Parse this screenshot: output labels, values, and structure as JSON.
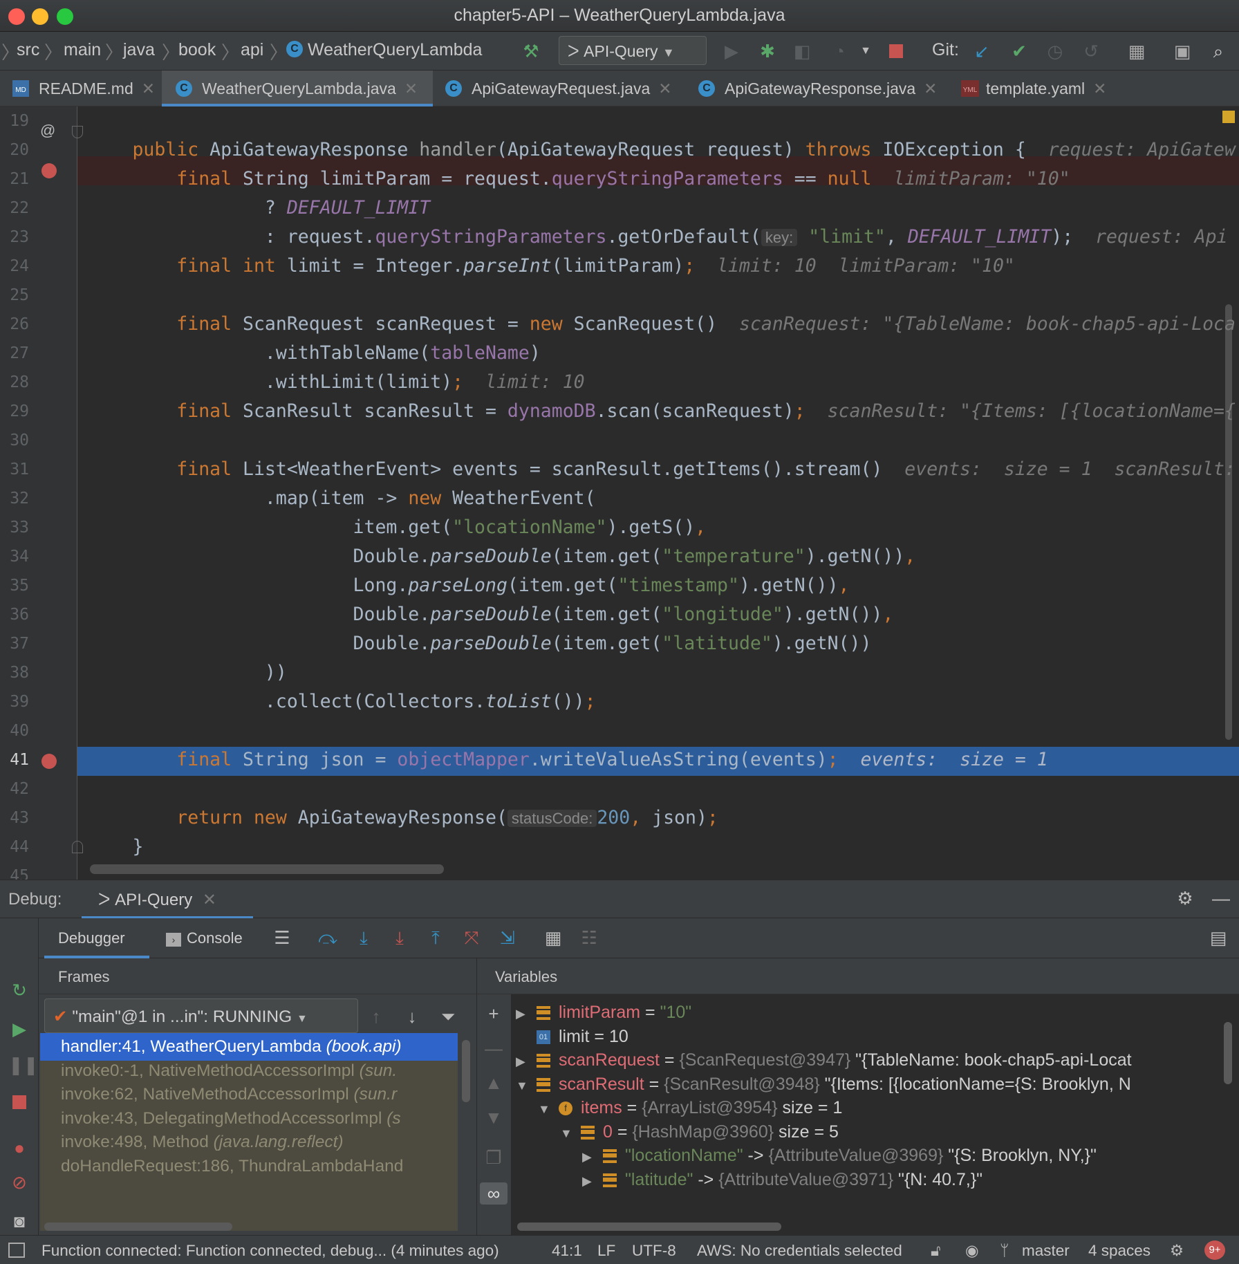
{
  "window": {
    "title": "chapter5-API – WeatherQueryLambda.java"
  },
  "breadcrumb": [
    "src",
    "main",
    "java",
    "book",
    "api",
    "WeatherQueryLambda"
  ],
  "toolbar": {
    "run_config": "API-Query",
    "git_label": "Git:"
  },
  "tabs": [
    {
      "label": "README.md",
      "icon": "markdown-icon"
    },
    {
      "label": "WeatherQueryLambda.java",
      "icon": "class-icon",
      "active": true
    },
    {
      "label": "ApiGatewayRequest.java",
      "icon": "class-icon"
    },
    {
      "label": "ApiGatewayResponse.java",
      "icon": "class-icon"
    },
    {
      "label": "template.yaml",
      "icon": "yaml-icon"
    }
  ],
  "editor": {
    "line_numbers": [
      "19",
      "20",
      "21",
      "22",
      "23",
      "24",
      "25",
      "26",
      "27",
      "28",
      "29",
      "30",
      "31",
      "32",
      "33",
      "34",
      "35",
      "36",
      "37",
      "38",
      "39",
      "40",
      "41",
      "42",
      "43",
      "44",
      "45"
    ],
    "hints": {
      "l20": "request: ApiGatew",
      "l21": "limitParam: \"10\"",
      "l23_key": "key:",
      "l23": "request: Api",
      "l24a": "limit: 10",
      "l24b": "limitParam: \"10\"",
      "l26": "scanRequest: \"{TableName: book-chap5-api-Loca",
      "l28": "limit: 10",
      "l29": "scanResult: \"{Items: [{locationName={",
      "l31a": "events:",
      "l31b": "size = 1",
      "l31c": "scanResult:",
      "l41a": "events:",
      "l41b": "size = 1",
      "l43_param": "statusCode:"
    }
  },
  "debug": {
    "title": "Debug:",
    "session_tab": "API-Query",
    "tabs": [
      "Debugger",
      "Console"
    ],
    "frames_header": "Frames",
    "variables_header": "Variables",
    "thread": "\"main\"@1 in ...in\": RUNNING",
    "frames": [
      {
        "method": "handler:41, WeatherQueryLambda",
        "pkg": "(book.api)"
      },
      {
        "method": "invoke0:-1, NativeMethodAccessorImpl",
        "pkg": "(sun."
      },
      {
        "method": "invoke:62, NativeMethodAccessorImpl",
        "pkg": "(sun.r"
      },
      {
        "method": "invoke:43, DelegatingMethodAccessorImpl",
        "pkg": "(s"
      },
      {
        "method": "invoke:498, Method",
        "pkg": "(java.lang.reflect)"
      },
      {
        "method": "doHandleRequest:186, ThundraLambdaHand",
        "pkg": ""
      }
    ],
    "variables": [
      {
        "name": "limitParam",
        "eq": " = ",
        "value": "\"10\"",
        "ref": "",
        "extra": ""
      },
      {
        "name": "limit",
        "eq": " = ",
        "value": "10",
        "ref": "",
        "extra": ""
      },
      {
        "name": "scanRequest",
        "eq": " = ",
        "value": "",
        "ref": "{ScanRequest@3947}",
        "extra": " \"{TableName: book-chap5-api-Locat"
      },
      {
        "name": "scanResult",
        "eq": " = ",
        "value": "",
        "ref": "{ScanResult@3948}",
        "extra": " \"{Items: [{locationName={S: Brooklyn, N"
      },
      {
        "name": "items",
        "eq": " = ",
        "value": "",
        "ref": "{ArrayList@3954}",
        "extra": "  size = 1"
      },
      {
        "name": "0",
        "eq": " = ",
        "value": "",
        "ref": "{HashMap@3960}",
        "extra": "  size = 5"
      },
      {
        "name": "\"locationName\"",
        "eq": " -> ",
        "value": "",
        "ref": "{AttributeValue@3969}",
        "extra": " \"{S: Brooklyn, NY,}\""
      },
      {
        "name": "\"latitude\"",
        "eq": " -> ",
        "value": "",
        "ref": "{AttributeValue@3971}",
        "extra": " \"{N: 40.7,}\""
      }
    ]
  },
  "status": {
    "message": "Function connected: Function connected, debug... (4 minutes ago)",
    "position": "41:1",
    "line_sep": "LF",
    "encoding": "UTF-8",
    "aws": "AWS: No credentials selected",
    "branch": "master",
    "indent": "4 spaces",
    "notifications": "9+"
  },
  "colors": {
    "accent": "#4a88c7",
    "selection": "#2f65ca",
    "breakpoint": "#c75450",
    "keyword": "#cc7832",
    "string": "#6a8759",
    "number": "#6897bb",
    "field": "#9876aa"
  }
}
